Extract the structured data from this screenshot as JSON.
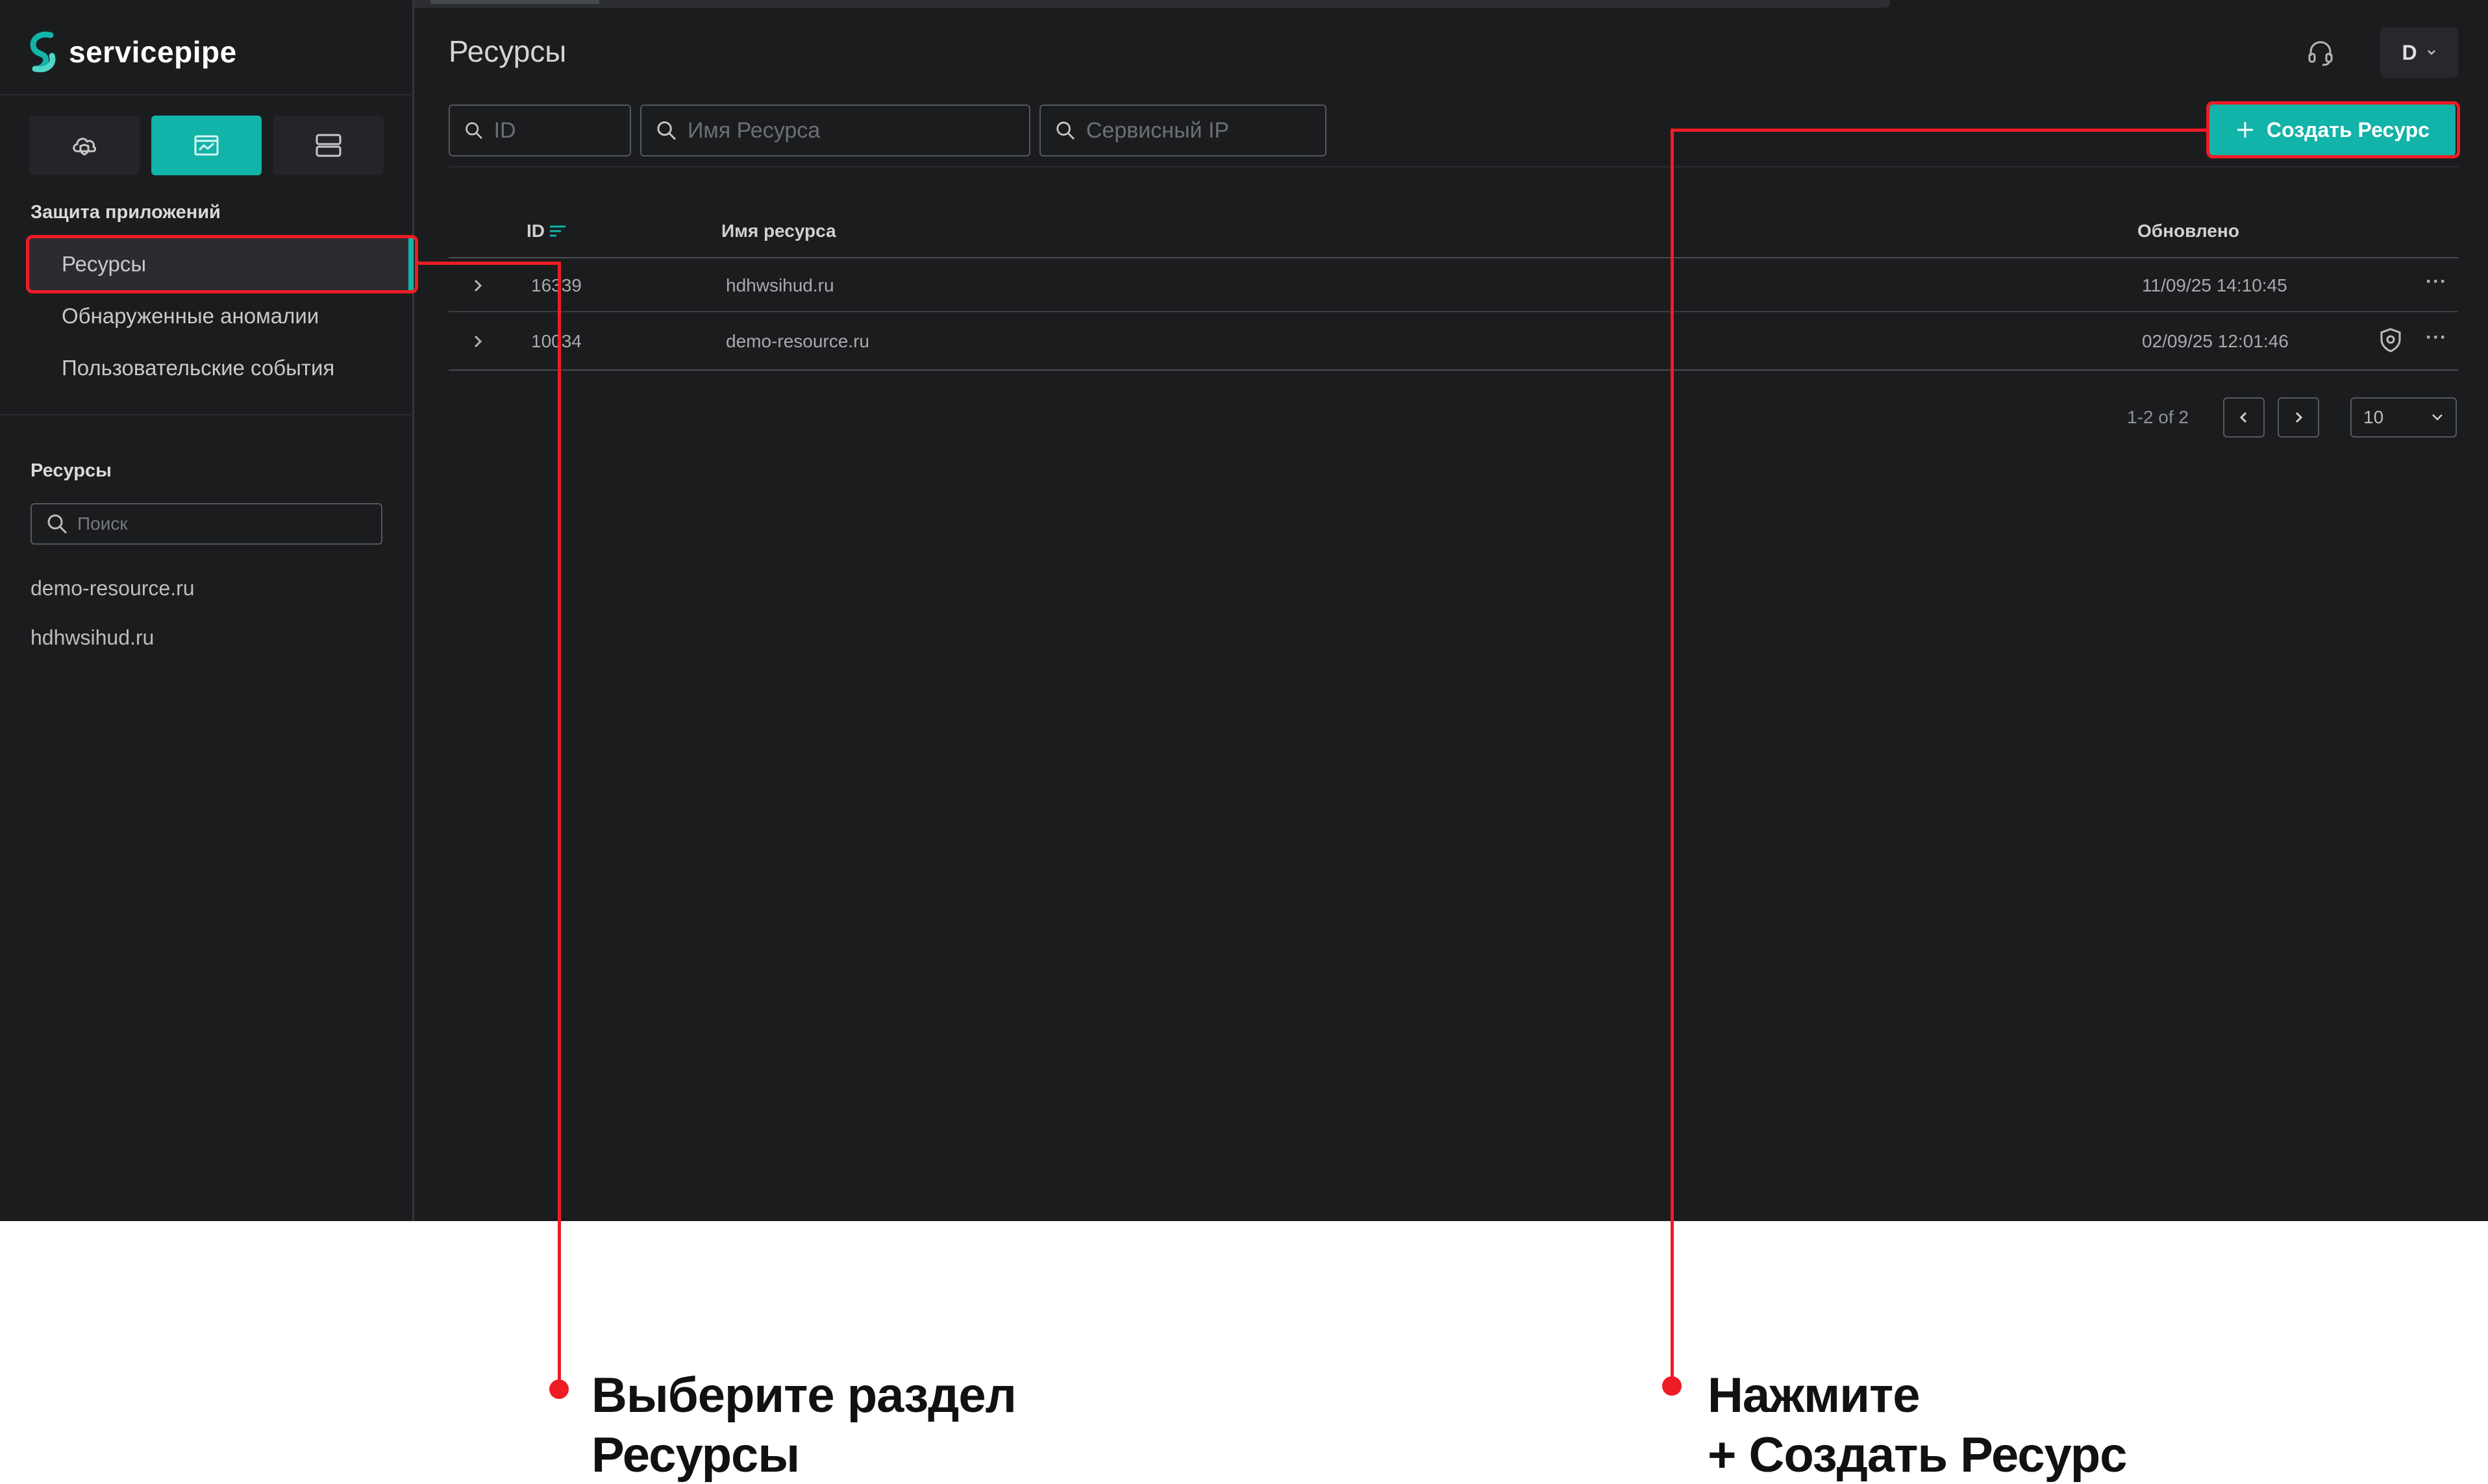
{
  "app": {
    "brand": "servicepipe"
  },
  "colors": {
    "accent": "#12b3a8",
    "annotation": "#ee1c25",
    "background": "#1b1c1e"
  },
  "sidebar": {
    "mode_tabs": [
      {
        "icon": "cloud-shield-icon",
        "active": false
      },
      {
        "icon": "browser-window-icon",
        "active": true
      },
      {
        "icon": "server-icon",
        "active": false
      }
    ],
    "section_title": "Защита приложений",
    "nav_items": [
      {
        "label": "Ресурсы",
        "active": true
      },
      {
        "label": "Обнаруженные аномалии",
        "active": false
      },
      {
        "label": "Пользовательские события",
        "active": false
      }
    ],
    "resources_title": "Ресурсы",
    "search_placeholder": "Поиск",
    "resources": [
      "demo-resource.ru",
      "hdhwsihud.ru"
    ]
  },
  "header": {
    "title": "Ресурсы",
    "user_initial": "D"
  },
  "filters": {
    "id_placeholder": "ID",
    "name_placeholder": "Имя Ресурса",
    "ip_placeholder": "Сервисный IP"
  },
  "create_button": "Создать Ресурс",
  "table": {
    "columns": {
      "id": "ID",
      "name": "Имя ресурса",
      "updated": "Обновлено"
    },
    "rows": [
      {
        "id": "16339",
        "name": "hdhwsihud.ru",
        "updated": "11/09/25 14:10:45",
        "shield": false
      },
      {
        "id": "10034",
        "name": "demo-resource.ru",
        "updated": "02/09/25 12:01:46",
        "shield": true
      }
    ]
  },
  "pagination": {
    "range": "1-2 of 2",
    "page_size": "10"
  },
  "annotations": {
    "left": {
      "line1": "Выберите раздел",
      "line2": "Ресурсы"
    },
    "right": {
      "line1": "Нажмите",
      "line2": "+ Создать Ресурс"
    }
  }
}
